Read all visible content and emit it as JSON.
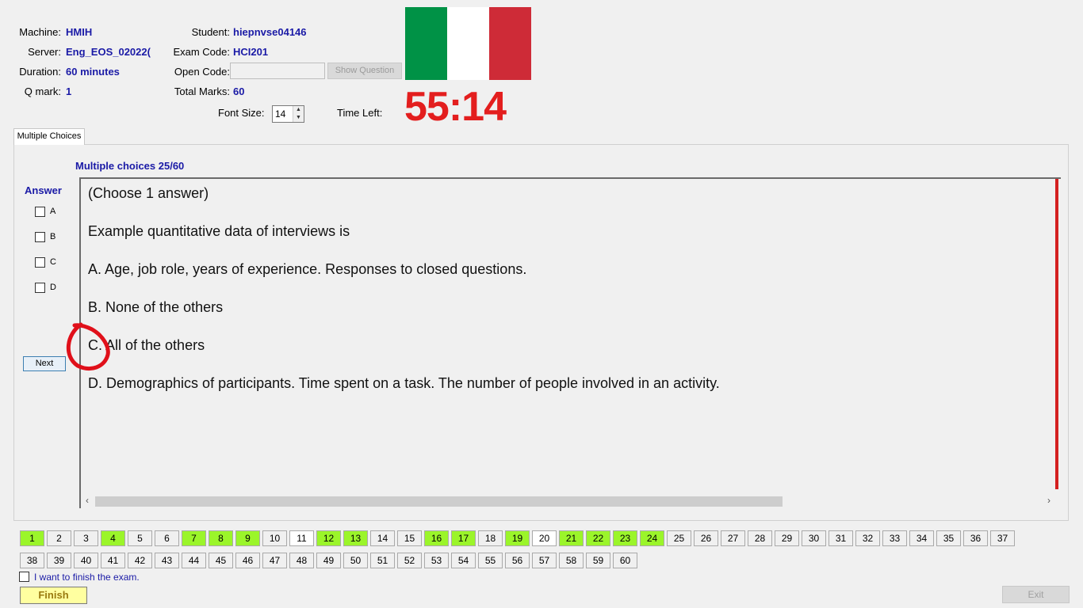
{
  "header": {
    "machine_label": "Machine:",
    "machine_value": "HMIH",
    "server_label": "Server:",
    "server_value": "Eng_EOS_02022(",
    "duration_label": "Duration:",
    "duration_value": "60 minutes",
    "qmark_label": "Q mark:",
    "qmark_value": "1",
    "student_label": "Student:",
    "student_value": "hiepnvse04146",
    "exam_code_label": "Exam Code:",
    "exam_code_value": "HCI201",
    "open_code_label": "Open Code:",
    "open_code_value": "",
    "show_question_label": "Show Question",
    "total_marks_label": "Total Marks:",
    "total_marks_value": "60",
    "font_size_label": "Font Size:",
    "font_size_value": "14",
    "time_left_label": "Time Left:",
    "time_left_value": "55:14",
    "flag_colors": [
      "#009246",
      "#ffffff",
      "#ce2b37"
    ]
  },
  "tab": {
    "label": "Multiple Choices"
  },
  "question": {
    "title": "Multiple choices 25/60",
    "answer_label": "Answer",
    "options": [
      "A",
      "B",
      "C",
      "D"
    ],
    "next_label": "Next",
    "lines": [
      "(Choose 1 answer)",
      "Example quantitative data of interviews is",
      "A.  Age, job role, years of experience. Responses to closed questions.",
      "B.  None of the others",
      "C.  All of the others",
      "D.  Demographics of participants. Time spent on a task. The number of people involved in an activity."
    ]
  },
  "nav": {
    "numbers": [
      "1",
      "2",
      "3",
      "4",
      "5",
      "6",
      "7",
      "8",
      "9",
      "10",
      "11",
      "12",
      "13",
      "14",
      "15",
      "16",
      "17",
      "18",
      "19",
      "20",
      "21",
      "22",
      "23",
      "24",
      "25",
      "26",
      "27",
      "28",
      "29",
      "30",
      "31",
      "32",
      "33",
      "34",
      "35",
      "36",
      "37",
      "38",
      "39",
      "40",
      "41",
      "42",
      "43",
      "44",
      "45",
      "46",
      "47",
      "48",
      "49",
      "50",
      "51",
      "52",
      "53",
      "54",
      "55",
      "56",
      "57",
      "58",
      "59",
      "60"
    ],
    "answered": [
      1,
      4,
      7,
      8,
      9,
      12,
      13,
      16,
      17,
      19,
      21,
      22,
      23,
      24
    ],
    "white": [
      11,
      20
    ]
  },
  "footer": {
    "finish_checkbox_label": "I want to finish the exam.",
    "finish_label": "Finish",
    "exit_label": "Exit"
  },
  "colors": {
    "accent": "#1a1aa6",
    "timer": "#e31e1e",
    "answered": "#9bf52a",
    "annotation": "#e0101a"
  }
}
